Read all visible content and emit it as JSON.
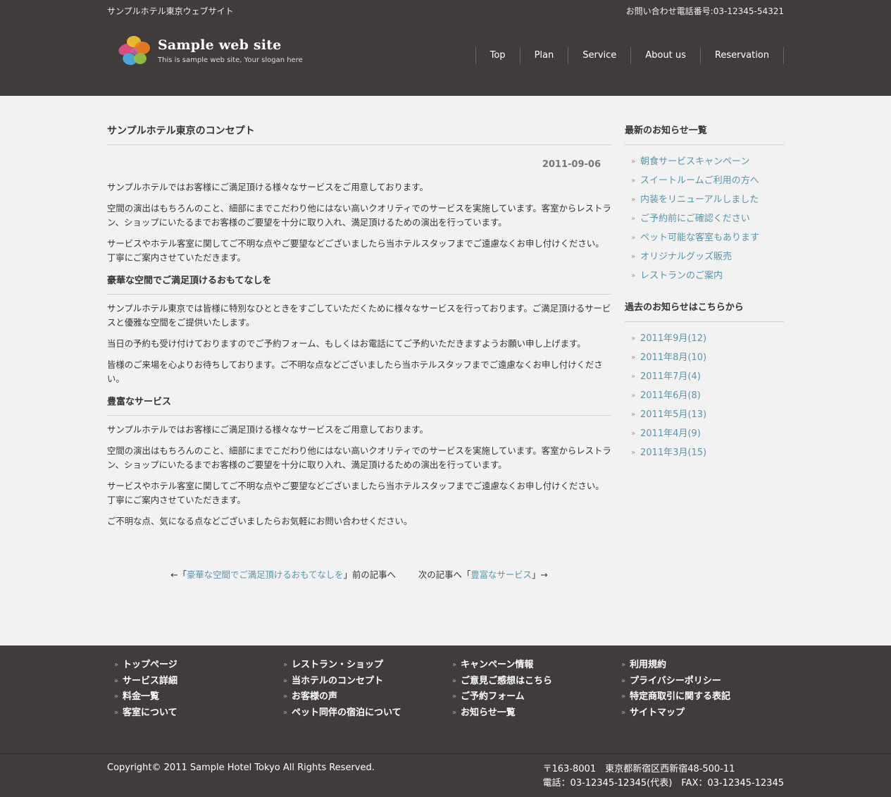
{
  "header": {
    "site_name": "サンプルホテル東京ウェブサイト",
    "contact": "お問い合わせ電話番号:03-12345-54321",
    "logo_title": "Sample web site",
    "logo_slogan": "This is sample web site, Your slogan here",
    "nav": [
      "Top",
      "Plan",
      "Service",
      "About us",
      "Reservation"
    ]
  },
  "article": {
    "title": "サンプルホテル東京のコンセプト",
    "date": "2011-09-06",
    "intro": [
      "サンプルホテルではお客様にご満足頂ける様々なサービスをご用意しております。",
      "空間の演出はもちろんのこと、細部にまでこだわり他にはない高いクオリティでのサービスを実施しています。客室からレストラン、ショップにいたるまでお客様のご要望を十分に取り入れ、満足頂けるための演出を行っています。",
      "サービスやホテル客室に関してご不明な点やご要望などございましたら当ホテルスタッフまでご遠慮なくお申し付けください。丁寧にご案内させていただきます。"
    ],
    "section1": {
      "heading": "豪華な空間でご満足頂けるおもてなしを",
      "paragraphs": [
        "サンプルホテル東京では皆様に特別なひとときをすごしていただくために様々なサービスを行っております。ご満足頂けるサービスと優雅な空間をご提供いたします。",
        "当日の予約も受け付けておりますのでご予約フォーム、もしくはお電話にてご予約いただきますようお願い申し上げます。",
        "皆様のご来場を心よりお待ちしております。ご不明な点などございましたら当ホテルスタッフまでご遠慮なくお申し付けください。"
      ]
    },
    "section2": {
      "heading": "豊富なサービス",
      "paragraphs": [
        "サンプルホテルではお客様にご満足頂ける様々なサービスをご用意しております。",
        "空間の演出はもちろんのこと、細部にまでこだわり他にはない高いクオリティでのサービスを実施しています。客室からレストラン、ショップにいたるまでお客様のご要望を十分に取り入れ、満足頂けるための演出を行っています。",
        "サービスやホテル客室に関してご不明な点やご要望などございましたら当ホテルスタッフまでご遠慮なくお申し付けください。丁寧にご案内させていただきます。",
        "ご不明な点、気になる点などございましたらお気軽にお問い合わせください。"
      ]
    },
    "nav": {
      "prev_prefix": "←「",
      "prev_link": "豪華な空間でご満足頂けるおもてなしを",
      "prev_suffix": "」前の記事へ",
      "next_prefix": "次の記事へ「",
      "next_link": "豊富なサービス",
      "next_suffix": "」→"
    }
  },
  "sidebar": {
    "news_title": "最新のお知らせ一覧",
    "news": [
      "朝食サービスキャンペーン",
      "スイートルームご利用の方へ",
      "内装をリニューアルしました",
      "ご予約前にご確認ください",
      "ペット可能な客室もあります",
      "オリジナルグッズ販売",
      "レストランのご案内"
    ],
    "archive_title": "過去のお知らせはこちらから",
    "archive": [
      "2011年9月(12)",
      "2011年8月(10)",
      "2011年7月(4)",
      "2011年6月(8)",
      "2011年5月(13)",
      "2011年4月(9)",
      "2011年3月(15)"
    ]
  },
  "footer": {
    "bullet": "»",
    "columns": [
      [
        "トップページ",
        "サービス詳細",
        "料金一覧",
        "客室について"
      ],
      [
        "レストラン・ショップ",
        "当ホテルのコンセプト",
        "お客様の声",
        "ペット同伴の宿泊について"
      ],
      [
        "キャンペーン情報",
        "ご意見ご感想はこちら",
        "ご予約フォーム",
        "お知らせ一覧"
      ],
      [
        "利用規約",
        "プライバシーポリシー",
        "特定商取引に関する表記",
        "サイトマップ"
      ]
    ],
    "copyright": "Copyright© 2011 Sample Hotel Tokyo All Rights Reserved.",
    "address_line1": "〒163-8001　東京都新宿区西新宿48-500-11",
    "address_line2": "電話：03-12345-12345(代表)　FAX：03-12345-12345"
  }
}
